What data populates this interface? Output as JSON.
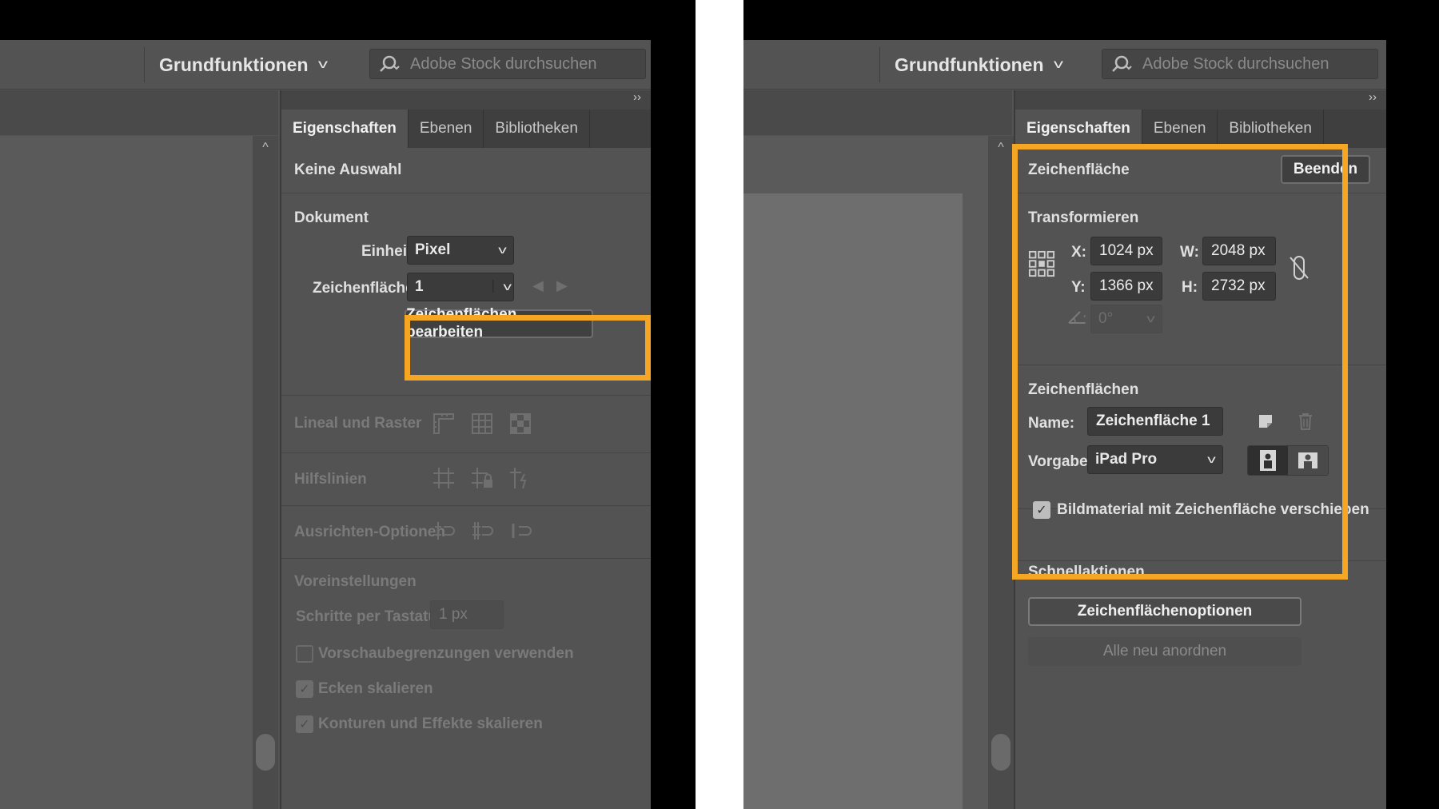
{
  "left": {
    "workspace": "Grundfunktionen",
    "search_placeholder": "Adobe Stock durchsuchen",
    "tabs": [
      "Eigenschaften",
      "Ebenen",
      "Bibliotheken"
    ],
    "selection_title": "Keine Auswahl",
    "document_title": "Dokument",
    "unit_label": "Einheit:",
    "unit_value": "Pixel",
    "artboard_label": "Zeichenfläche:",
    "artboard_value": "1",
    "edit_button": "Zeichenflächen bearbeiten",
    "ruler_grid": "Lineal und Raster",
    "guides": "Hilfslinien",
    "align_options": "Ausrichten-Optionen",
    "preferences": "Voreinstellungen",
    "keyboard_step_label": "Schritte per Tastatur:",
    "keyboard_step_value": "1 px",
    "preview_bounds": "Vorschaubegrenzungen verwenden",
    "scale_corners": "Ecken skalieren",
    "scale_strokes": "Konturen und Effekte skalieren"
  },
  "right": {
    "workspace": "Grundfunktionen",
    "search_placeholder": "Adobe Stock durchsuchen",
    "tabs": [
      "Eigenschaften",
      "Ebenen",
      "Bibliotheken"
    ],
    "artboard_title": "Zeichenfläche",
    "exit_button": "Beenden",
    "transform_title": "Transformieren",
    "x_label": "X:",
    "x_value": "1024 px",
    "y_label": "Y:",
    "y_value": "1366 px",
    "w_label": "W:",
    "w_value": "2048 px",
    "h_label": "H:",
    "h_value": "2732 px",
    "angle_value": "0°",
    "artboards_title": "Zeichenflächen",
    "name_label": "Name:",
    "name_value": "Zeichenfläche 1",
    "preset_label": "Vorgabe:",
    "preset_value": "iPad Pro",
    "move_artwork": "Bildmaterial mit Zeichenfläche verschieben",
    "quick_actions_title": "Schnellaktionen",
    "options_button": "Zeichenflächenoptionen",
    "rearrange_button": "Alle neu anordnen"
  },
  "colors": {
    "highlight": "#f5a623",
    "panel": "#535353",
    "dark": "#3b3b3b"
  }
}
